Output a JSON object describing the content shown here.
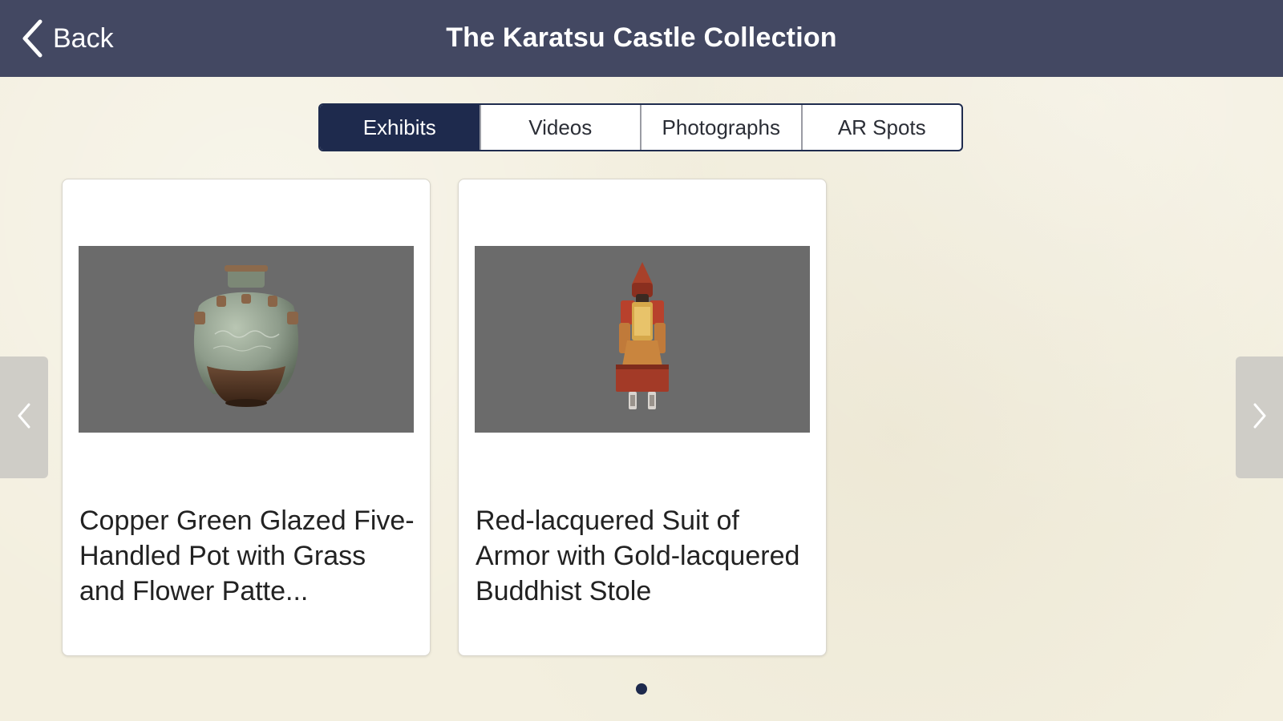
{
  "header": {
    "back_label": "Back",
    "title": "The Karatsu Castle Collection",
    "background_color": "#434862"
  },
  "tabs": [
    {
      "label": "Exhibits",
      "active": true
    },
    {
      "label": "Videos",
      "active": false
    },
    {
      "label": "Photographs",
      "active": false
    },
    {
      "label": "AR Spots",
      "active": false
    }
  ],
  "cards": [
    {
      "title": "Copper Green Glazed Five-Handled Pot with Grass and Flower Patte...",
      "image": "pot-image"
    },
    {
      "title": "Red-lacquered Suit of Armor with Gold-lacquered Buddhist Stole",
      "image": "armor-image"
    }
  ],
  "navigation": {
    "prev_icon": "chevron-left-icon",
    "next_icon": "chevron-right-icon"
  },
  "pagination": {
    "current_page": 1,
    "total_pages": 1
  },
  "colors": {
    "accent": "#1e2a4d",
    "page_background": "#f3efdf"
  }
}
